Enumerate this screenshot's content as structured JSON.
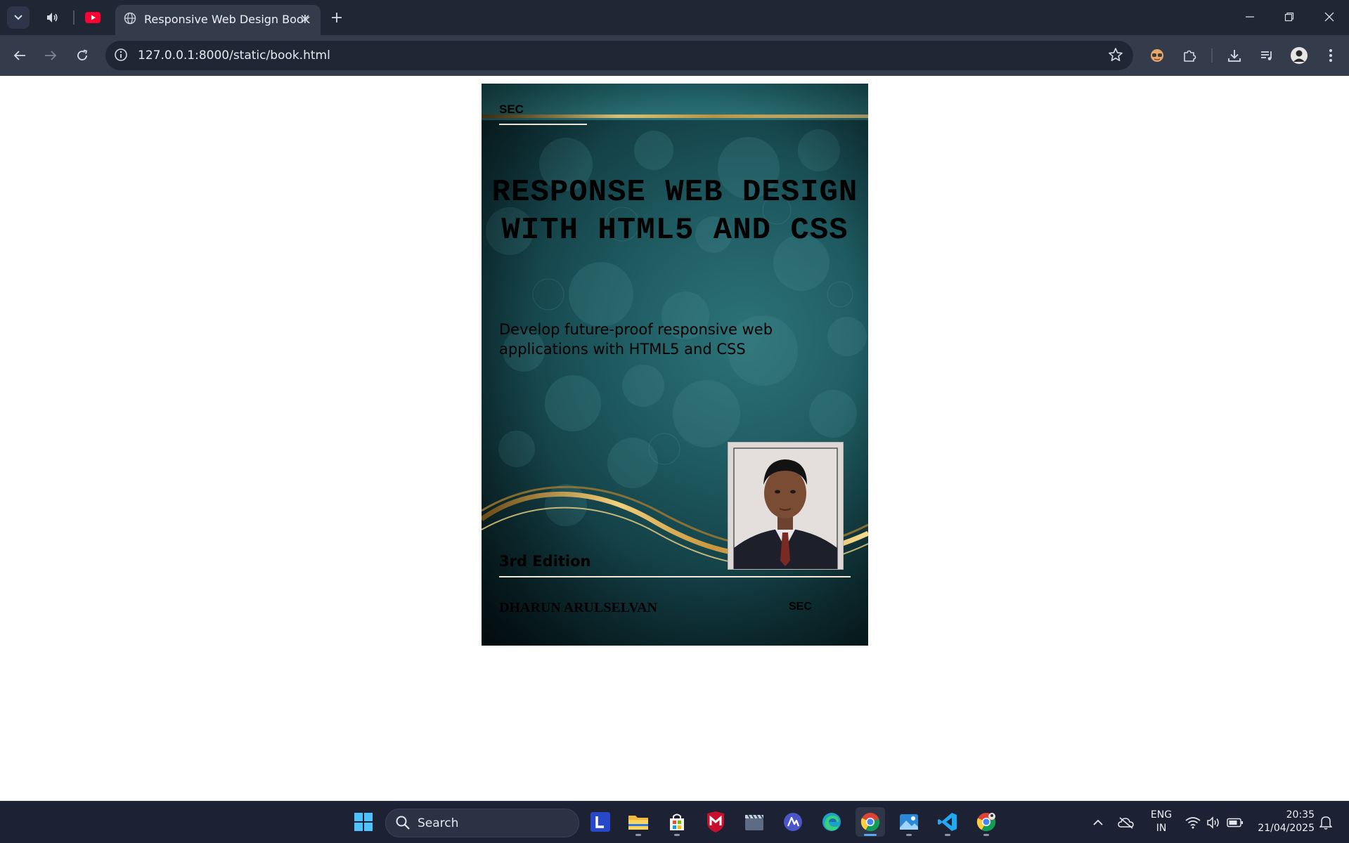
{
  "browser": {
    "tab_title": "Responsive Web Design Book",
    "url": "127.0.0.1:8000/static/book.html"
  },
  "cover": {
    "publisher_top": "SEC",
    "title": "RESPONSE WEB DESIGN WITH HTML5 AND CSS",
    "subtitle": "Develop future-proof responsive web applications with HTML5 and CSS",
    "edition": "3rd Edition",
    "author": "DHARUN ARULSELVAN",
    "publisher_bottom": "SEC"
  },
  "taskbar": {
    "search_label": "Search",
    "language_line1": "ENG",
    "language_line2": "IN",
    "time": "20:35",
    "date": "21/04/2025"
  },
  "colors": {
    "chrome_dark": "#1f2634",
    "chrome_light": "#343c4c",
    "cover_teal": "#1f5d63",
    "gold": "#d4a94a",
    "taskbar": "#1c2233"
  }
}
